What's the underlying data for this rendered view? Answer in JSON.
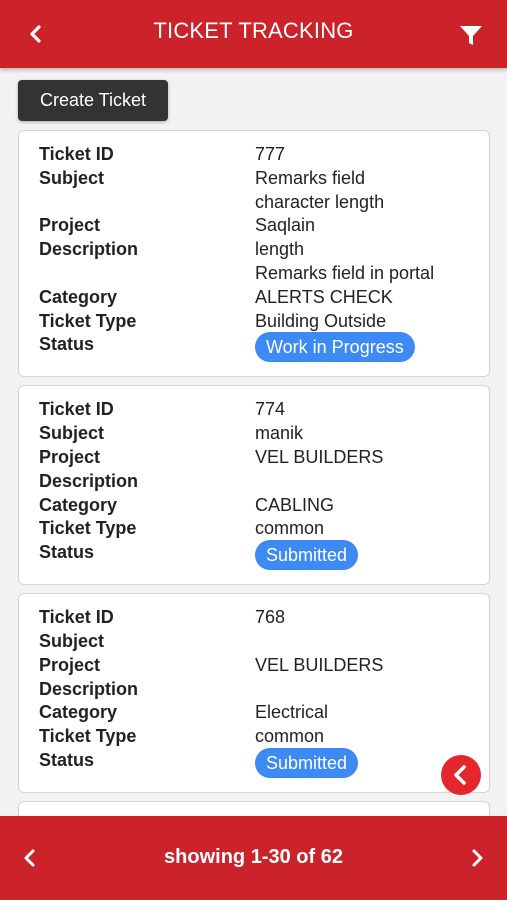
{
  "header": {
    "title": "TICKET TRACKING",
    "back_icon": "back-chevron-icon",
    "filter_icon": "filter-funnel-icon",
    "color": "#cc2229"
  },
  "toolbar": {
    "create_label": "Create Ticket"
  },
  "labels": {
    "ticket_id": "Ticket ID",
    "subject": "Subject",
    "project": "Project",
    "description": "Description",
    "category": "Category",
    "ticket_type": "Ticket Type",
    "status": "Status"
  },
  "tickets": [
    {
      "ticket_id": "777",
      "subject_lines": [
        "Remarks field",
        "character length"
      ],
      "project": "Saqlain",
      "description_lines": [
        "length",
        "Remarks field in portal"
      ],
      "category": "ALERTS CHECK",
      "ticket_type": "Building Outside",
      "status": "Work in Progress"
    },
    {
      "ticket_id": "774",
      "subject_lines": [
        "manik"
      ],
      "project": "VEL BUILDERS",
      "description_lines": [
        ""
      ],
      "category": "CABLING",
      "ticket_type": "common",
      "status": "Submitted"
    },
    {
      "ticket_id": "768",
      "subject_lines": [
        ""
      ],
      "project": "VEL BUILDERS",
      "description_lines": [
        ""
      ],
      "category": "Electrical",
      "ticket_type": "common",
      "status": "Submitted"
    }
  ],
  "status_color": "#3d8af5",
  "fab": {
    "icon": "collapse-chevron-left-icon",
    "color": "#e5262d"
  },
  "pagination": {
    "text": "showing 1-30 of 62",
    "prev_icon": "prev-page-icon",
    "next_icon": "next-page-icon"
  }
}
